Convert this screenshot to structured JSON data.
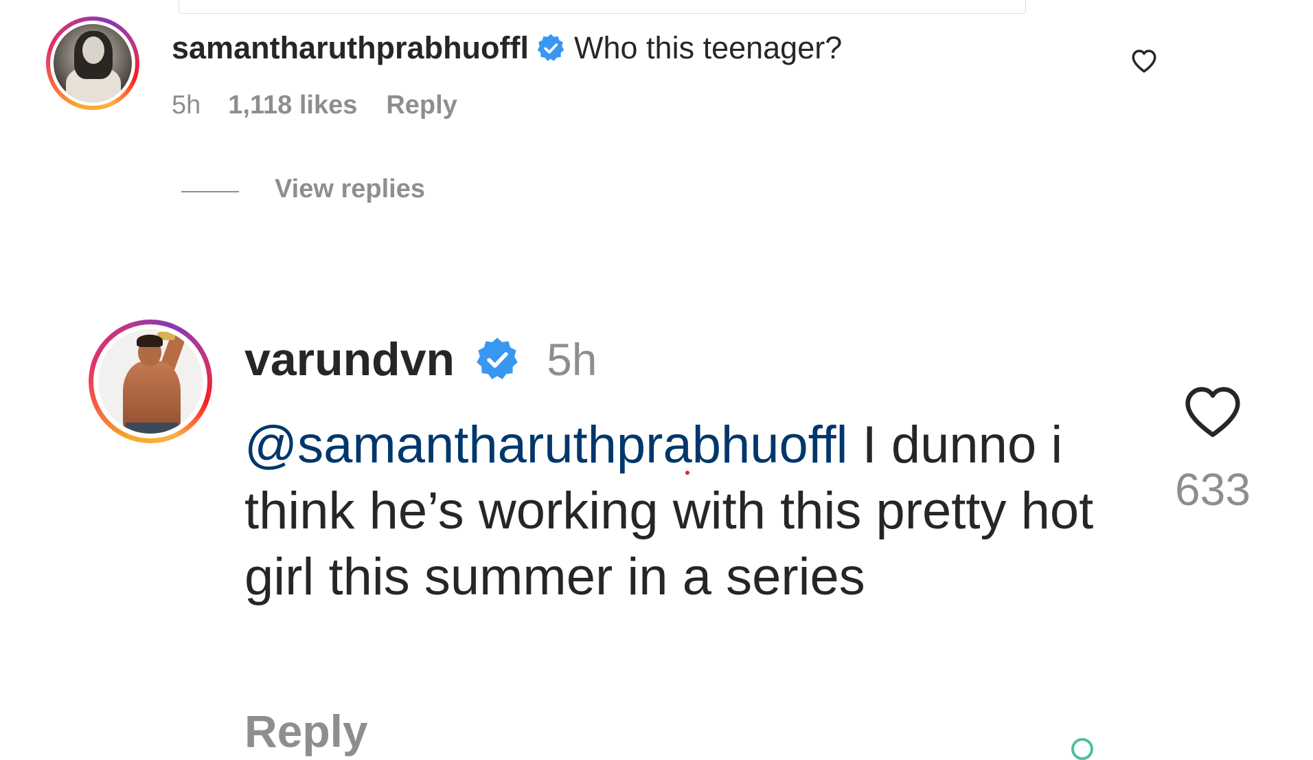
{
  "comments": [
    {
      "username": "samantharuthprabhuoffl",
      "verified": true,
      "text": "Who this teenager?",
      "time": "5h",
      "likes": "1,118 likes",
      "reply_label": "Reply",
      "view_replies_label": "View replies"
    },
    {
      "username": "varundvn",
      "verified": true,
      "time": "5h",
      "mention": "@samantharuthprabhuoffl",
      "text": " I dunno i think he’s working with this pretty hot girl this summer in a series",
      "like_count": "633",
      "reply_label": "Reply"
    }
  ],
  "icons": {
    "verified": "verified-badge-icon",
    "like": "heart-outline-icon"
  },
  "colors": {
    "verified_blue": "#3897f0",
    "mention_blue": "#00376b",
    "text_primary": "#262626",
    "text_secondary": "#8e8e8e"
  }
}
